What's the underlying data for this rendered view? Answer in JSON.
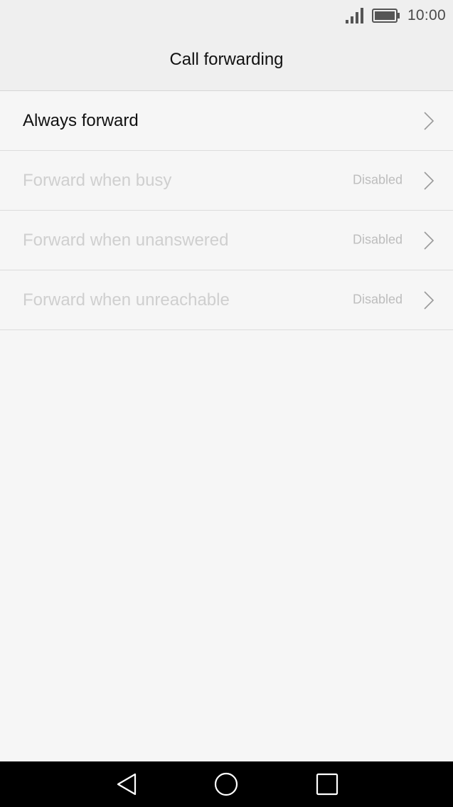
{
  "status_bar": {
    "time": "10:00",
    "icons": [
      "signal-icon",
      "battery-icon"
    ]
  },
  "header": {
    "title": "Call forwarding"
  },
  "list": {
    "items": [
      {
        "label": "Always forward",
        "value": "",
        "enabled": true
      },
      {
        "label": "Forward when busy",
        "value": "Disabled",
        "enabled": false
      },
      {
        "label": "Forward when unanswered",
        "value": "Disabled",
        "enabled": false
      },
      {
        "label": "Forward when unreachable",
        "value": "Disabled",
        "enabled": false
      }
    ]
  },
  "nav_bar": {
    "icons": [
      "back-icon",
      "home-icon",
      "recents-icon"
    ]
  },
  "colors": {
    "background": "#f6f6f6",
    "header_background": "#efefef",
    "primary_text": "#111111",
    "disabled_text": "#cfcfcf",
    "secondary_text": "#bdbdbd",
    "nav_bar_background": "#000000"
  }
}
